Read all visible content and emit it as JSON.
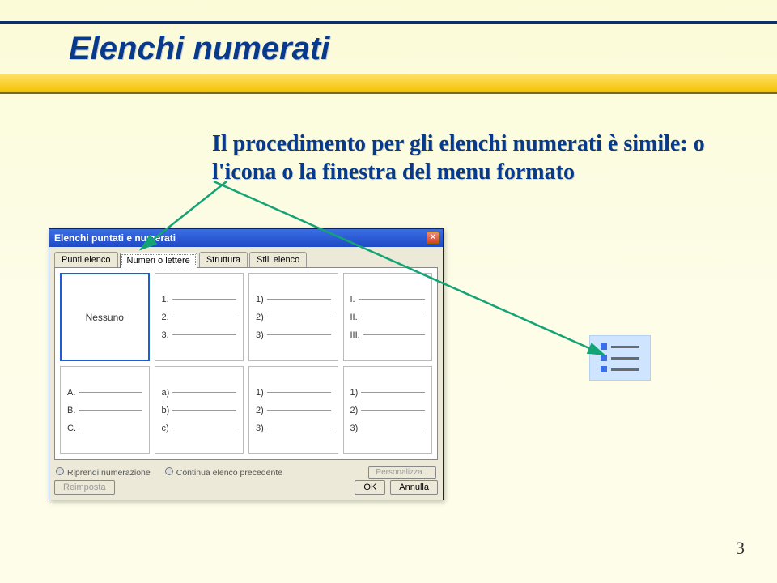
{
  "title": "Elenchi numerati",
  "body": "Il procedimento per gli elenchi numerati è simile: o l'icona o la finestra del menu formato",
  "page_number": "3",
  "dialog": {
    "title": "Elenchi puntati e numerati",
    "close": "×",
    "tabs": [
      "Punti elenco",
      "Numeri o lettere",
      "Struttura",
      "Stili elenco"
    ],
    "active_tab": 1,
    "cells": {
      "none": "Nessuno",
      "c1": [
        "1.",
        "2.",
        "3."
      ],
      "c2": [
        "1)",
        "2)",
        "3)"
      ],
      "c3": [
        "I.",
        "II.",
        "III."
      ],
      "c4": [
        "A.",
        "B.",
        "C."
      ],
      "c5": [
        "a)",
        "b)",
        "c)"
      ],
      "c6": [
        "1)",
        "2)",
        "3)"
      ],
      "c7": [
        "1)",
        "2)",
        "3)"
      ]
    },
    "radios": {
      "restart": "Riprendi numerazione",
      "continue": "Continua elenco precedente"
    },
    "buttons": {
      "customize": "Personalizza...",
      "reset": "Reimposta",
      "ok": "OK",
      "cancel": "Annulla"
    }
  }
}
